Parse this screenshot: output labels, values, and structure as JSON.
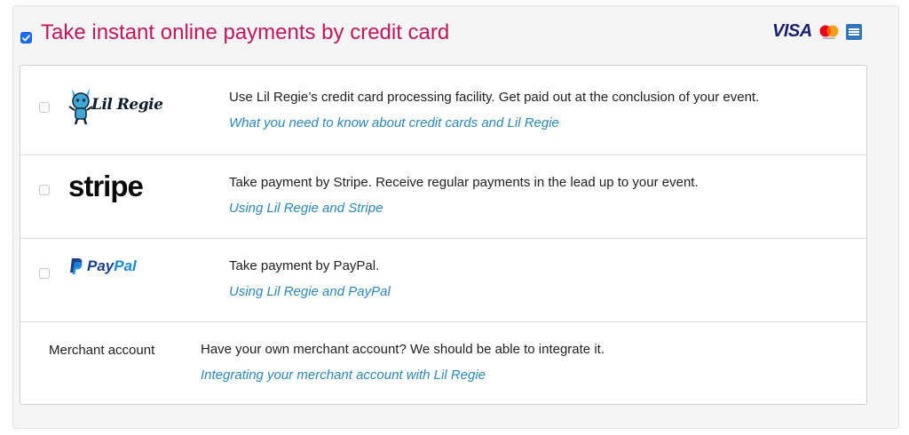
{
  "header": {
    "title": "Take instant online payments by credit card",
    "enabled": true,
    "card_brands": [
      {
        "name": "visa",
        "label": "VISA"
      },
      {
        "name": "mastercard"
      },
      {
        "name": "amex"
      }
    ]
  },
  "methods": [
    {
      "id": "lilregie",
      "logo_text": "Lil Regie",
      "description": "Use Lil Regie’s credit card processing facility. Get paid out at the conclusion of your event.",
      "link": "What you need to know about credit cards and Lil Regie",
      "checked": false
    },
    {
      "id": "stripe",
      "logo_text": "stripe",
      "description": "Take payment by Stripe. Receive regular payments in the lead up to your event.",
      "link": "Using Lil Regie and Stripe",
      "checked": false
    },
    {
      "id": "paypal",
      "logo_text_1": "Pay",
      "logo_text_2": "Pal",
      "description": "Take payment by PayPal.",
      "link": "Using Lil Regie and PayPal",
      "checked": false
    },
    {
      "id": "merchant",
      "label": "Merchant account",
      "description": "Have your own merchant account? We should be able to integrate it.",
      "link": "Integrating your merchant account with Lil Regie"
    }
  ],
  "colors": {
    "heading": "#c0185a",
    "link": "#2a87bf",
    "checkbox_checked": "#1b6ef3"
  }
}
